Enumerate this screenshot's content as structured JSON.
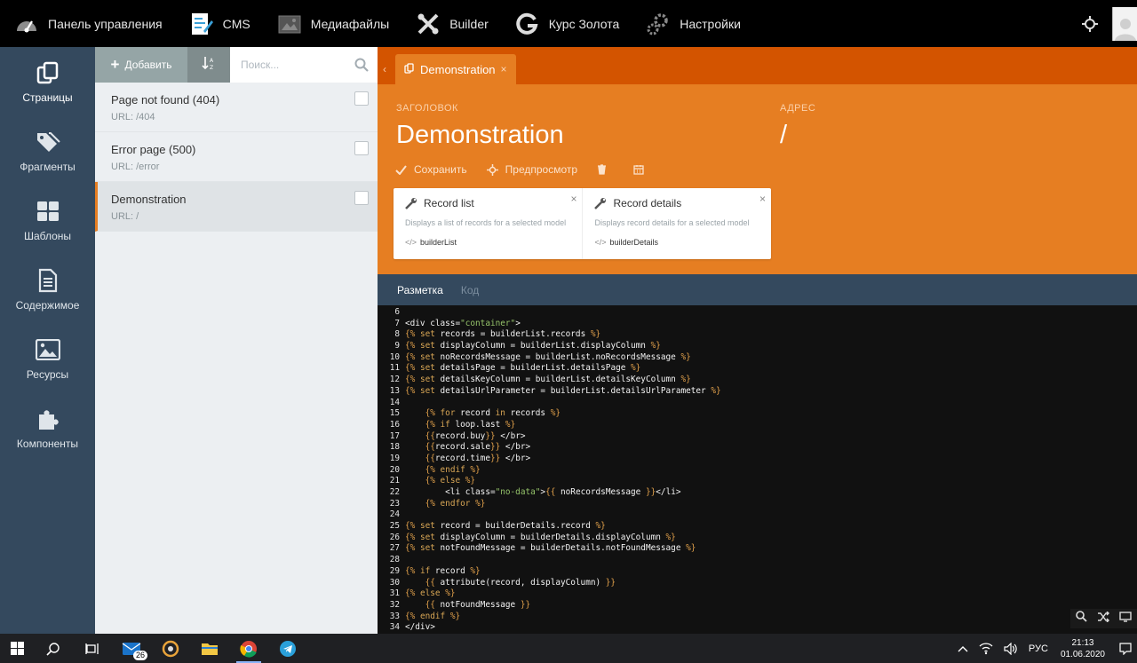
{
  "topnav": {
    "items": [
      {
        "label": "Панель управления",
        "icon": "dashboard-icon"
      },
      {
        "label": "CMS",
        "icon": "cms-icon"
      },
      {
        "label": "Медиафайлы",
        "icon": "media-icon"
      },
      {
        "label": "Builder",
        "icon": "builder-icon"
      },
      {
        "label": "Курс Золота",
        "icon": "gold-plugin-icon"
      },
      {
        "label": "Настройки",
        "icon": "settings-icon"
      }
    ]
  },
  "sidebar": {
    "items": [
      {
        "label": "Страницы",
        "icon": "pages-icon",
        "active": true
      },
      {
        "label": "Фрагменты",
        "icon": "tags-icon"
      },
      {
        "label": "Шаблоны",
        "icon": "layouts-icon"
      },
      {
        "label": "Содержимое",
        "icon": "content-icon"
      },
      {
        "label": "Ресурсы",
        "icon": "assets-icon"
      },
      {
        "label": "Компоненты",
        "icon": "components-icon"
      }
    ]
  },
  "pagelist": {
    "add_label": "Добавить",
    "search_placeholder": "Поиск...",
    "pages": [
      {
        "title": "Page not found (404)",
        "url": "URL: /404"
      },
      {
        "title": "Error page (500)",
        "url": "URL: /error"
      },
      {
        "title": "Demonstration",
        "url": "URL: /",
        "active": true
      }
    ]
  },
  "editor": {
    "tab_label": "Demonstration",
    "title_label": "ЗАГОЛОВОК",
    "title_value": "Demonstration",
    "url_label": "АДРЕС",
    "url_value": "/",
    "save_label": "Сохранить",
    "preview_label": "Предпросмотр",
    "components": [
      {
        "name": "Record list",
        "desc": "Displays a list of records for a selected model",
        "alias": "builderList"
      },
      {
        "name": "Record details",
        "desc": "Displays record details for a selected model",
        "alias": "builderDetails"
      }
    ],
    "code_tabs": {
      "markup": "Разметка",
      "code": "Код"
    }
  },
  "code_lines": [
    {
      "n": "6",
      "t": ""
    },
    {
      "n": "7",
      "t": "<div class=\"container\">"
    },
    {
      "n": "8",
      "t": "{% set records = builderList.records %}"
    },
    {
      "n": "9",
      "t": "{% set displayColumn = builderList.displayColumn %}"
    },
    {
      "n": "10",
      "t": "{% set noRecordsMessage = builderList.noRecordsMessage %}"
    },
    {
      "n": "11",
      "t": "{% set detailsPage = builderList.detailsPage %}"
    },
    {
      "n": "12",
      "t": "{% set detailsKeyColumn = builderList.detailsKeyColumn %}"
    },
    {
      "n": "13",
      "t": "{% set detailsUrlParameter = builderList.detailsUrlParameter %}"
    },
    {
      "n": "14",
      "t": ""
    },
    {
      "n": "15",
      "t": "    {% for record in records %}"
    },
    {
      "n": "16",
      "t": "    {% if loop.last %}"
    },
    {
      "n": "17",
      "t": "    {{record.buy}} </br>"
    },
    {
      "n": "18",
      "t": "    {{record.sale}} </br>"
    },
    {
      "n": "19",
      "t": "    {{record.time}} </br>"
    },
    {
      "n": "20",
      "t": "    {% endif %}"
    },
    {
      "n": "21",
      "t": "    {% else %}"
    },
    {
      "n": "22",
      "t": "        <li class=\"no-data\">{{ noRecordsMessage }}</li>"
    },
    {
      "n": "23",
      "t": "    {% endfor %}"
    },
    {
      "n": "24",
      "t": ""
    },
    {
      "n": "25",
      "t": "{% set record = builderDetails.record %}"
    },
    {
      "n": "26",
      "t": "{% set displayColumn = builderDetails.displayColumn %}"
    },
    {
      "n": "27",
      "t": "{% set notFoundMessage = builderDetails.notFoundMessage %}"
    },
    {
      "n": "28",
      "t": ""
    },
    {
      "n": "29",
      "t": "{% if record %}"
    },
    {
      "n": "30",
      "t": "    {{ attribute(record, displayColumn) }}"
    },
    {
      "n": "31",
      "t": "{% else %}"
    },
    {
      "n": "32",
      "t": "    {{ notFoundMessage }}"
    },
    {
      "n": "33",
      "t": "{% endif %}"
    },
    {
      "n": "34",
      "t": "</div>"
    }
  ],
  "taskbar": {
    "mail_badge": "26",
    "lang": "РУС",
    "time": "21:13",
    "date": "01.06.2020"
  },
  "colors": {
    "accent": "#e67e22",
    "accent_dark": "#d35400",
    "sidebar": "#34495e"
  }
}
